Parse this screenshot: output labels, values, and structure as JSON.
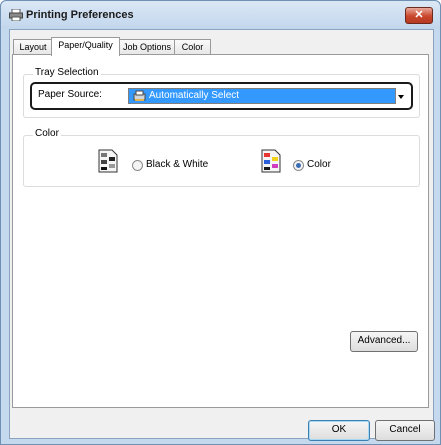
{
  "window": {
    "title": "Printing Preferences",
    "close_glyph": "✕",
    "icon": "printer-icon"
  },
  "tabs": [
    {
      "label": "Layout",
      "active": false
    },
    {
      "label": "Paper/Quality",
      "active": true
    },
    {
      "label": "Job Options",
      "active": false
    },
    {
      "label": "Color",
      "active": false
    }
  ],
  "tray_selection": {
    "group_label": "Tray Selection",
    "paper_source_label": "Paper Source:",
    "paper_source_value": "Automatically Select"
  },
  "color_group": {
    "group_label": "Color",
    "options": [
      {
        "label": "Black & White",
        "selected": false,
        "icon": "black-white-document-icon"
      },
      {
        "label": "Color",
        "selected": true,
        "icon": "color-document-icon"
      }
    ]
  },
  "buttons": {
    "advanced": "Advanced...",
    "ok": "OK",
    "cancel": "Cancel"
  },
  "colors": {
    "selection_highlight": "#3399ff",
    "title_bar": "#c4d8ee",
    "close_button": "#c9462c"
  }
}
